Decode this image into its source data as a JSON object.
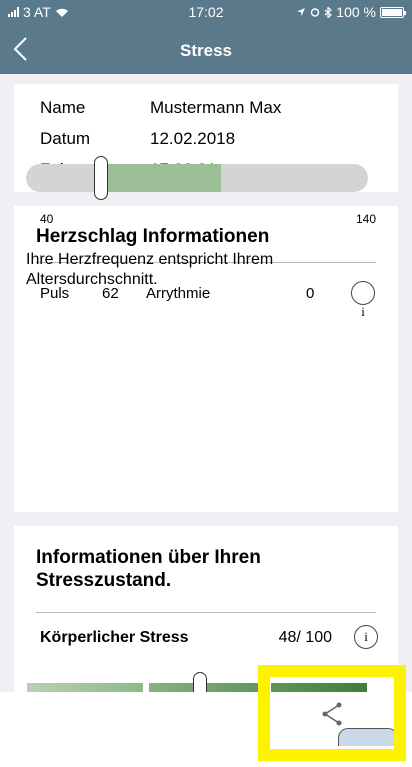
{
  "status_bar": {
    "carrier": "3 AT",
    "time": "17:02",
    "battery": "100 %"
  },
  "nav": {
    "title": "Stress"
  },
  "info": [
    {
      "key": "Name",
      "value": "Mustermann Max"
    },
    {
      "key": "Datum",
      "value": "12.02.2018"
    },
    {
      "key": "Zeit",
      "value": "17:02:21"
    }
  ],
  "heart": {
    "title": "Herzschlag Informationen",
    "puls_label": "Puls",
    "puls_value": "62",
    "arrythmie_label": "Arrythmie",
    "arrythmie_value": "0",
    "info_glyph": "i",
    "scale_min": "40",
    "scale_max": "140",
    "range_from": 60,
    "range_to": 97,
    "current": 62,
    "text": "Ihre Herzfrequenz entspricht Ihrem Altersdurchschnitt."
  },
  "stress": {
    "title": "Informationen über Ihren Stresszustand.",
    "koerperlich_label": "Körperlicher Stress",
    "koerperlich_value": "48/ 100",
    "info_glyph": "i"
  },
  "colors": {
    "nav_bg": "#5a7a8c",
    "range_green": "#9dbf98",
    "track_gray": "#d4d4d4",
    "highlight_yellow": "#fff200"
  },
  "icons": {
    "back": "chevron-left-icon",
    "share": "share-icon",
    "info": "info-circle-icon"
  }
}
